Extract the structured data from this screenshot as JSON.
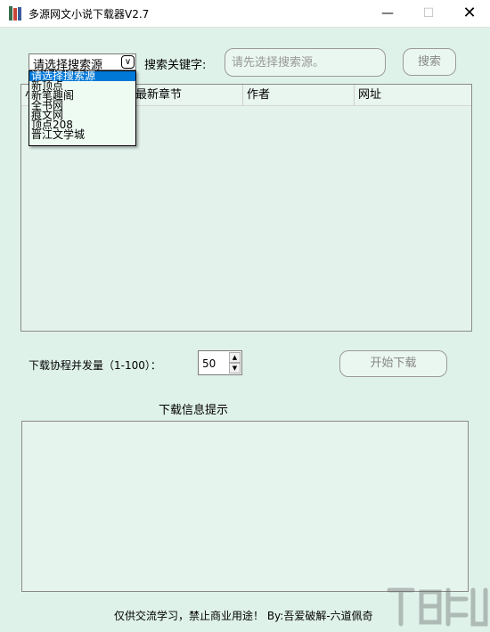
{
  "window": {
    "title": "多源网文小说下载器V2.7",
    "minimize_glyph": "—",
    "maximize_glyph": "☐",
    "close_glyph": "✕"
  },
  "search": {
    "source_selected": "请选择搜索源",
    "source_options": [
      "请选择搜索源",
      "新顶点",
      "新笔趣阁",
      "全书网",
      "痕文网",
      "顶点208",
      "晋江文学城"
    ],
    "keyword_label": "搜索关键字:",
    "keyword_placeholder": "请先选择搜索源。",
    "search_button": "搜索"
  },
  "results_table": {
    "columns": [
      "小",
      "最新章节",
      "作者",
      "网址"
    ],
    "rows": []
  },
  "download": {
    "concurrency_label": "下载协程并发量（1-100）：",
    "concurrency_value": "50",
    "start_button": "开始下载"
  },
  "info": {
    "label": "下载信息提示",
    "content": ""
  },
  "footer": {
    "text": "仅供交流学习，禁止商业用途！ By:吾爱破解-六道佩奇"
  },
  "colors": {
    "background": "#dff2ea",
    "selection": "#0078d7",
    "dropdown_bg": "#eefbf3"
  }
}
